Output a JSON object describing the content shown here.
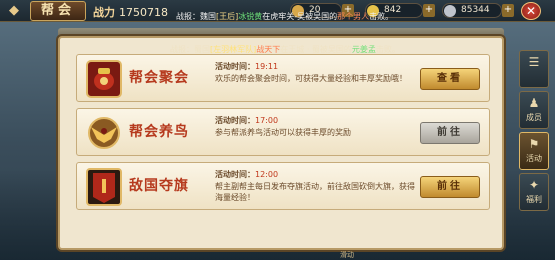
{
  "header": {
    "title": "帮会",
    "power_label": "战力",
    "power_value": "1750718"
  },
  "resources": [
    {
      "name": "stamina",
      "value": "20",
      "color": "#d8a84a"
    },
    {
      "name": "ingot",
      "value": "842",
      "color": "#e6c24a"
    },
    {
      "name": "silver",
      "value": "85344",
      "color": "#bfc4cc"
    }
  ],
  "ticker_top": {
    "prefix": "战报：魏国",
    "rank": "[王后]",
    "name_a": "冰锐黄",
    "mid": "在虎牢关",
    "sep": "-",
    "rest": "吴被吴国的",
    "name_b": "那个男人",
    "tail": "击败。"
  },
  "ticker_panel": {
    "prefix": "战报：蜀国",
    "rank": "[左羽林军队]",
    "name_a": "战天下",
    "mid": "在王城 · 蜀被吴国的",
    "name_b": "元姜孟",
    "tail": "击败。"
  },
  "activities": [
    {
      "name": "帮会聚会",
      "time_label": "活动时间：",
      "time_value": "19:11",
      "desc": "欢乐的帮会聚会时间，可获得大量经验和丰厚奖励哦！",
      "button": "查看",
      "button_style": "gold",
      "emblem": "jar-emblem-icon"
    },
    {
      "name": "帮会养鸟",
      "time_label": "活动时间：",
      "time_value": "17:00",
      "desc": "参与帮派养鸟活动可以获得丰厚的奖励",
      "button": "前往",
      "button_style": "gray",
      "emblem": "bird-emblem-icon"
    },
    {
      "name": "敌国夺旗",
      "time_label": "活动时间：",
      "time_value": "12:00",
      "desc": "帮主副帮主每日发布夺旗活动，前往敌国砍倒大旗，获得海量经验！",
      "button": "前往",
      "button_style": "gold",
      "emblem": "flag-emblem-icon"
    }
  ],
  "side_menu": [
    {
      "label": "",
      "icon": "list-icon"
    },
    {
      "label": "成员",
      "icon": "members-icon"
    },
    {
      "label": "活动",
      "icon": "activity-icon",
      "active": true
    },
    {
      "label": "福利",
      "icon": "gift-icon"
    }
  ],
  "footer_hint": "滑动"
}
